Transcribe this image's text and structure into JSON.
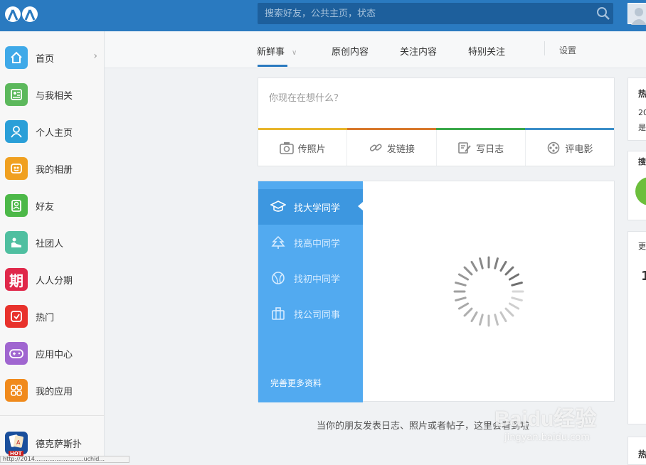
{
  "search": {
    "placeholder": "搜索好友，公共主页，状态"
  },
  "sidebar": {
    "items": [
      {
        "label": "首页",
        "icon": "home-icon",
        "color": "#3fa9e8"
      },
      {
        "label": "与我相关",
        "icon": "contact-card-icon",
        "color": "#5cb85c"
      },
      {
        "label": "个人主页",
        "icon": "user-icon",
        "color": "#2a9fd8"
      },
      {
        "label": "我的相册",
        "icon": "album-icon",
        "color": "#f0a020"
      },
      {
        "label": "好友",
        "icon": "friends-icon",
        "color": "#4cb848"
      },
      {
        "label": "社团人",
        "icon": "club-icon",
        "color": "#4fbfa0"
      },
      {
        "label": "人人分期",
        "icon": "installment-icon",
        "color": "#e0284a",
        "glyph": "期"
      },
      {
        "label": "热门",
        "icon": "hot-icon",
        "color": "#e8322c"
      },
      {
        "label": "应用中心",
        "icon": "gamepad-icon",
        "color": "#a066d0"
      },
      {
        "label": "我的应用",
        "icon": "apps-grid-icon",
        "color": "#f08a1c"
      },
      {
        "label": "德克萨斯扑",
        "icon": "poker-game-icon",
        "color": "#1a4f9c",
        "badge": "HOT"
      }
    ]
  },
  "tabs": {
    "items": [
      "新鲜事",
      "原创内容",
      "关注内容",
      "特别关注"
    ],
    "settings": "设置"
  },
  "composer": {
    "placeholder": "你现在在想什么？",
    "actions": [
      {
        "label": "传照片",
        "icon": "camera-icon"
      },
      {
        "label": "发链接",
        "icon": "link-icon"
      },
      {
        "label": "写日志",
        "icon": "write-note-icon"
      },
      {
        "label": "评电影",
        "icon": "film-reel-icon"
      }
    ],
    "bar_colors": [
      "#e8b52c",
      "#d8782c",
      "#3aa84a",
      "#3a8ec8"
    ]
  },
  "finder": {
    "items": [
      {
        "label": "找大学同学",
        "icon": "graduation-cap-icon",
        "active": true
      },
      {
        "label": "找高中同学",
        "icon": "tree-icon",
        "active": false
      },
      {
        "label": "找初中同学",
        "icon": "ball-icon",
        "active": false
      },
      {
        "label": "找公司同事",
        "icon": "briefcase-icon",
        "active": false
      }
    ],
    "more": "完善更多资料"
  },
  "hint": "当你的朋友发表日志、照片或者帖子，这里会看到啦",
  "right": {
    "cards": [
      {
        "t1": "热",
        "t2": "20",
        "t3": "是"
      },
      {
        "t1": "搜"
      },
      {
        "t1": "更"
      },
      {
        "t1": "热"
      }
    ]
  },
  "statusbar": "http://2014...........................uchid...",
  "watermark": {
    "text": "Baidu经验",
    "url": "jingyan.baidu.com"
  }
}
